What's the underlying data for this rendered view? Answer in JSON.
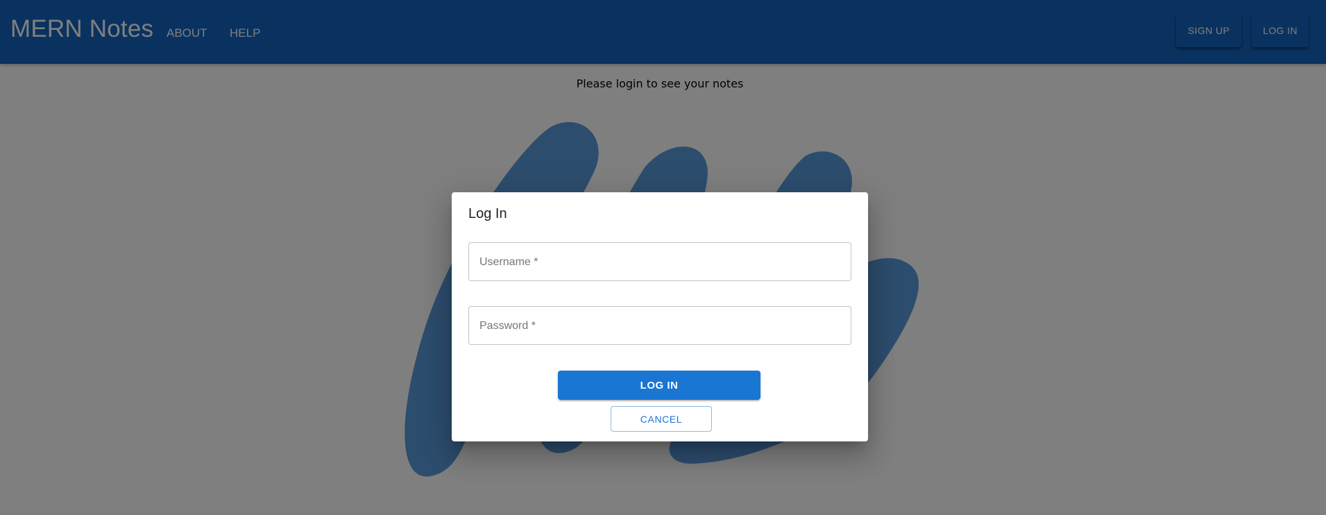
{
  "app": {
    "title": "MERN Notes",
    "nav": [
      {
        "label": "ABOUT"
      },
      {
        "label": "HELP"
      }
    ],
    "actions": {
      "signup_label": "SIGN UP",
      "login_label": "LOG IN"
    }
  },
  "main": {
    "message": "Please login to see your notes"
  },
  "dialog": {
    "title": "Log In",
    "username_placeholder": "Username *",
    "password_placeholder": "Password *",
    "submit_label": "LOG IN",
    "cancel_label": "CANCEL"
  },
  "colors": {
    "appbar": "#1565c0",
    "primary": "#1976d2",
    "illustration": "#4a90d9"
  }
}
